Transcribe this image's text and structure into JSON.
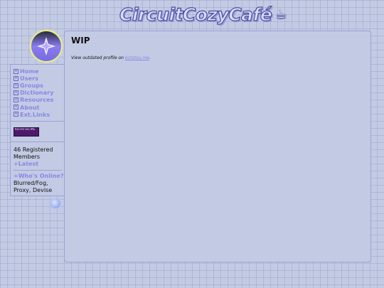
{
  "site": {
    "title": "CircuitCozyCafé",
    "cup_icon": "coffee-cup-icon"
  },
  "nav": [
    {
      "label": "Home"
    },
    {
      "label": "Users"
    },
    {
      "label": "Groups"
    },
    {
      "label": "Dictionary"
    },
    {
      "label": "Resources"
    },
    {
      "label": "About"
    },
    {
      "label": "Ext.Links"
    }
  ],
  "banner": {
    "text": "KOTATSU.ME"
  },
  "stats": {
    "members": "46 Registered Members",
    "latest_label": "Latest",
    "online_label": "Who's Online?",
    "online_list": "Blurred/Fog, Proxy, Devise"
  },
  "main": {
    "title": "WIP",
    "profile_prefix": "View outdated profile on ",
    "profile_link": "kotatsu.me",
    "profile_suffix": "."
  },
  "colors": {
    "accent": "#8a86e6",
    "border": "#9aa0d8",
    "background": "#c3cbe4"
  }
}
